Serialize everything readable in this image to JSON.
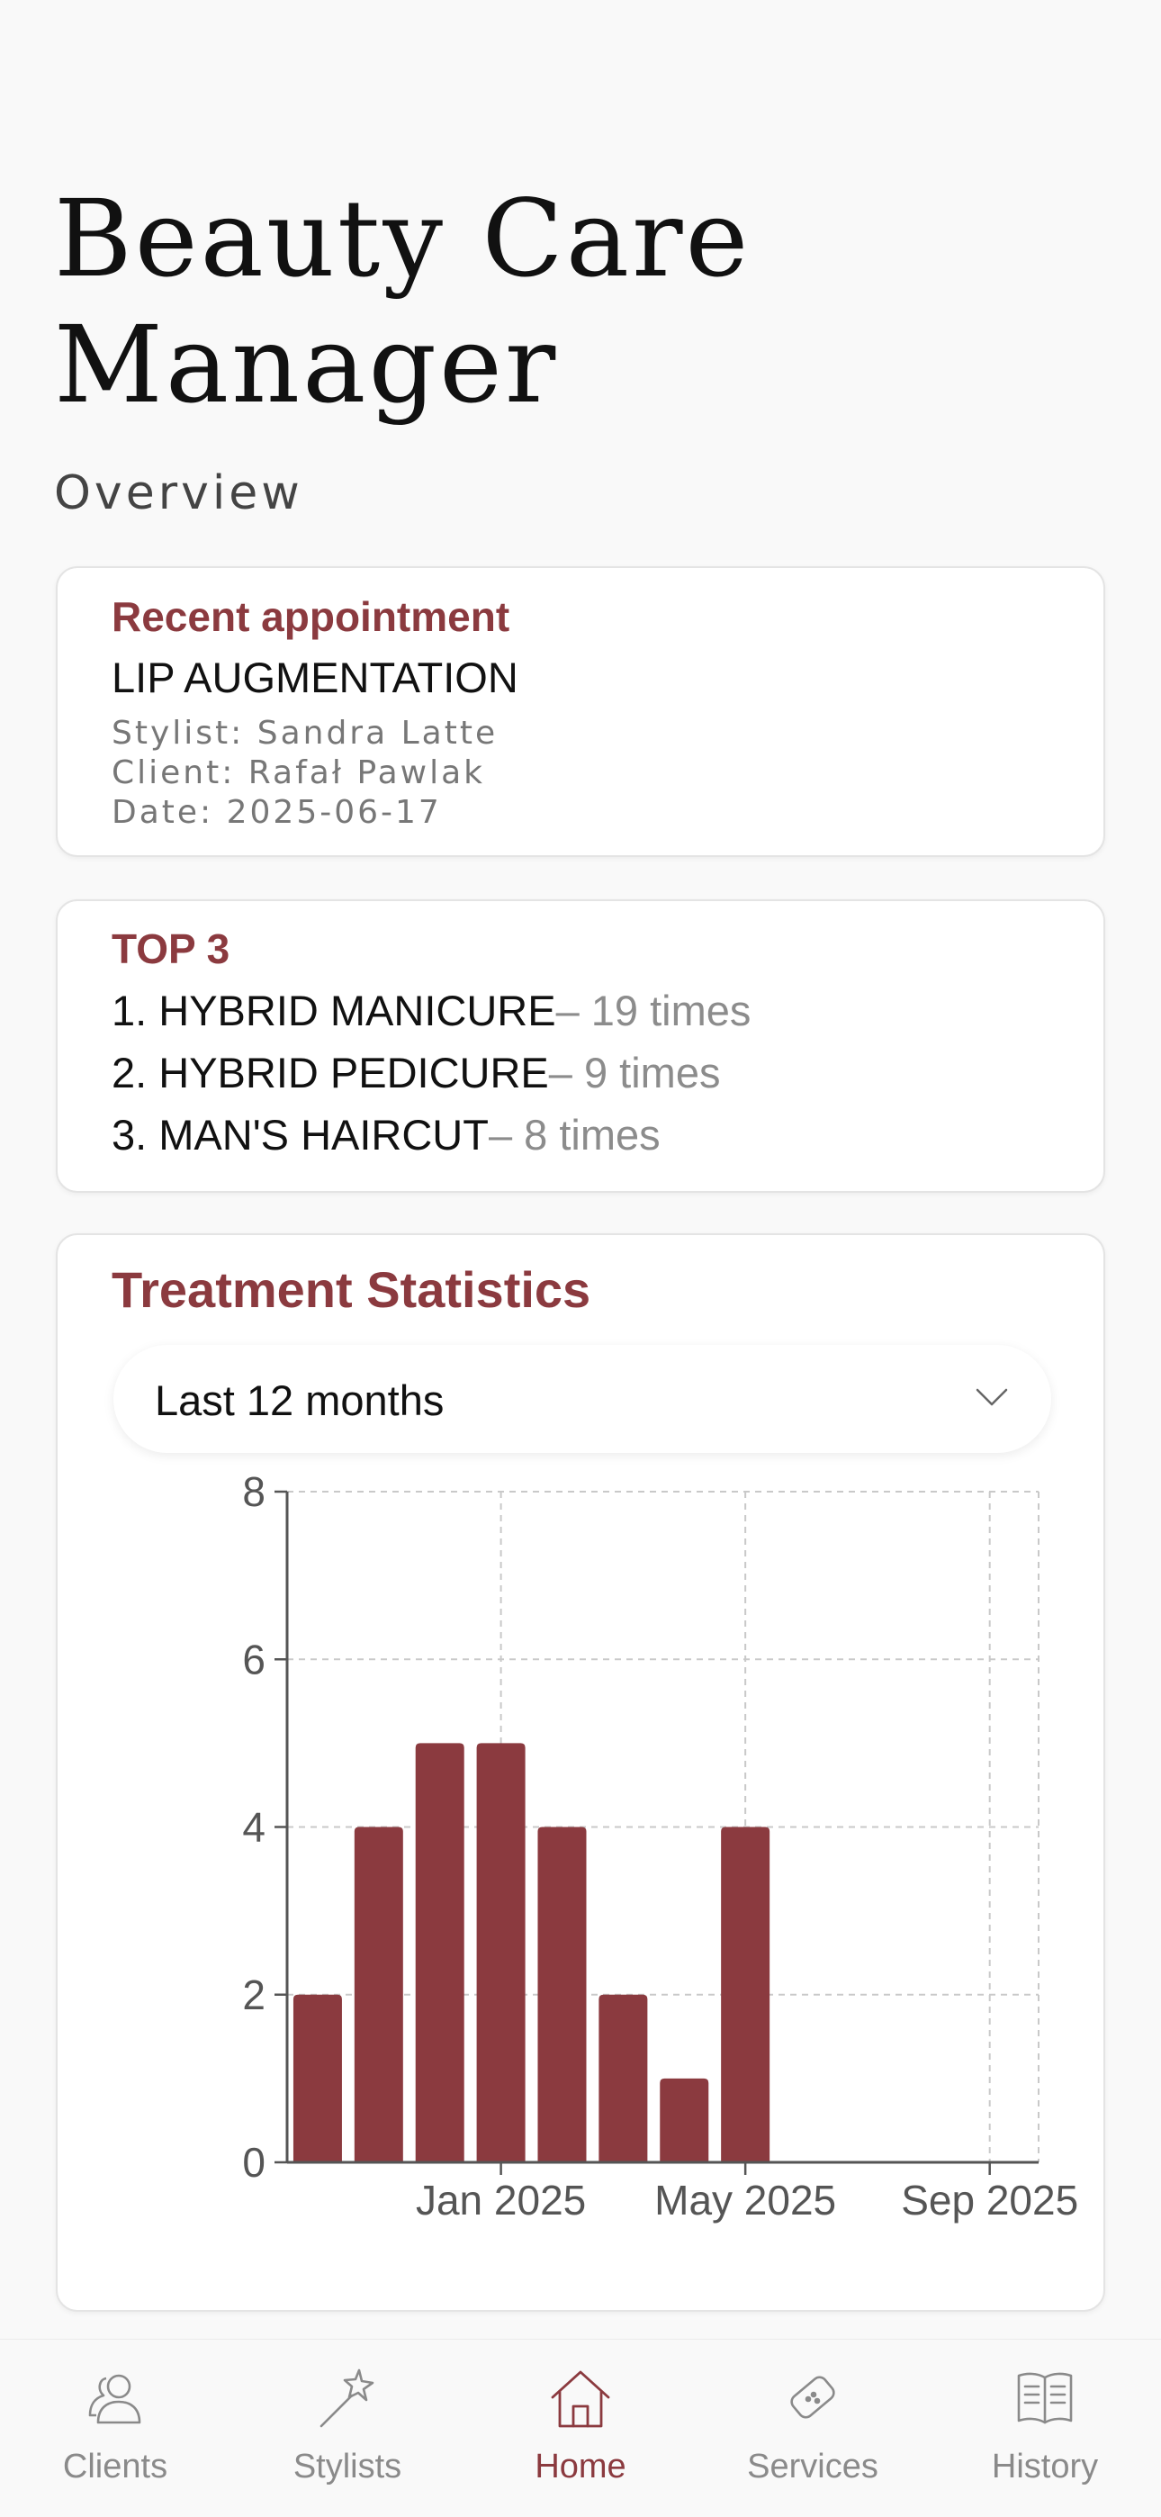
{
  "app": {
    "title": "Beauty Care Manager",
    "section": "Overview"
  },
  "recent": {
    "heading": "Recent appointment",
    "treatment": "LIP AUGMENTATION",
    "stylist": "Stylist: Sandra Latte",
    "client": "Client: Rafał Pawlak",
    "date": "Date: 2025-06-17"
  },
  "top3": {
    "heading": "TOP 3",
    "items": [
      {
        "name": "1. HYBRID MANICURE",
        "count": "– 19 times"
      },
      {
        "name": "2. HYBRID PEDICURE",
        "count": "– 9 times"
      },
      {
        "name": "3. MAN'S HAIRCUT",
        "count": "– 8 times"
      }
    ]
  },
  "stats": {
    "heading": "Treatment Statistics",
    "period": "Last 12 months",
    "chevron_icon": "chevron-down-icon"
  },
  "chart_data": {
    "type": "bar",
    "title": "",
    "xlabel": "",
    "ylabel": "",
    "x_ticks": [
      "Jan 2025",
      "May 2025",
      "Sep 2025"
    ],
    "x_range": [
      "2024-09",
      "2025-09"
    ],
    "ylim": [
      0,
      8
    ],
    "y_ticks": [
      0,
      2,
      4,
      6,
      8
    ],
    "grid": true,
    "color": "#8b3a3f",
    "categories": [
      "2024-10",
      "2024-11",
      "2024-12",
      "2025-01",
      "2025-02",
      "2025-03",
      "2025-04",
      "2025-05"
    ],
    "values": [
      2,
      4,
      5,
      5,
      4,
      2,
      1,
      4
    ]
  },
  "tabs": [
    {
      "label": "Clients",
      "icon": "users-icon",
      "active": false
    },
    {
      "label": "Stylists",
      "icon": "magic-wand-icon",
      "active": false
    },
    {
      "label": "Home",
      "icon": "home-icon",
      "active": true
    },
    {
      "label": "Services",
      "icon": "bandage-icon",
      "active": false
    },
    {
      "label": "History",
      "icon": "book-icon",
      "active": false
    }
  ],
  "colors": {
    "accent": "#8b3a3f",
    "muted": "#8a8a8a",
    "background": "#f9f9f9"
  }
}
